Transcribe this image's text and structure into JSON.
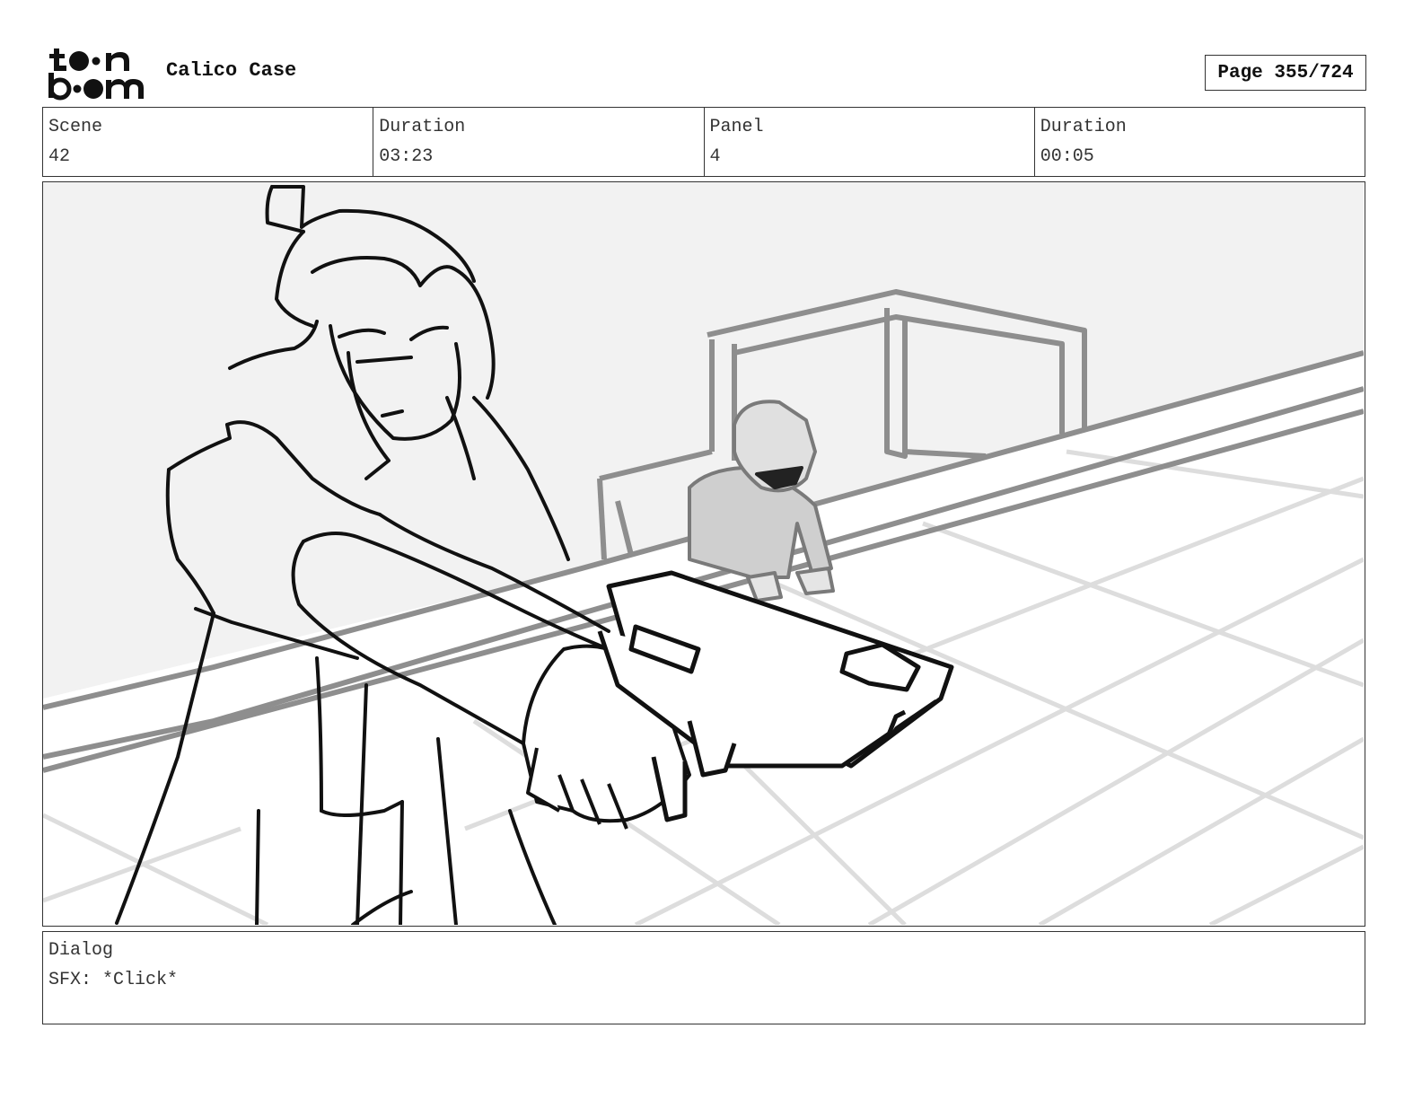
{
  "header": {
    "logo_text": "toonboom",
    "project_title": "Calico Case",
    "page_indicator": "Page 355/724"
  },
  "meta": {
    "scene_label": "Scene",
    "scene_value": "42",
    "scene_duration_label": "Duration",
    "scene_duration_value": "03:23",
    "panel_label": "Panel",
    "panel_value": "4",
    "panel_duration_label": "Duration",
    "panel_duration_value": "00:05"
  },
  "dialog": {
    "label": "Dialog",
    "text": "SFX: *Click*"
  }
}
